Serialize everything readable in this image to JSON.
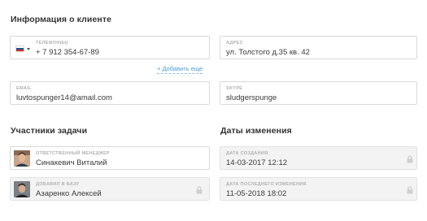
{
  "client_info": {
    "title": "Информация о клиенте",
    "phone": {
      "label": "ТЕЛЕФОН(Ы)",
      "value": "+ 7 912 354-67-89",
      "country_flag": "ru-flag-icon"
    },
    "address": {
      "label": "АДРЕС",
      "value": "ул. Толстого д.35 кв. 42"
    },
    "add_more": "+ Добавить еще",
    "email": {
      "label": "EMAIL",
      "value": "luvtospunger14@amail.com"
    },
    "skype": {
      "label": "SKYPE",
      "value": "sludgerspunge"
    }
  },
  "participants": {
    "title": "Участники задачи",
    "manager": {
      "label": "ОТВЕТСТВЕННЫЙ МЕНЕДЖЕР",
      "value": "Синакевич Виталий"
    },
    "added_by": {
      "label": "ДОБАВИЛ В БАЗУ",
      "value": "Азаренко Алексей"
    }
  },
  "dates": {
    "title": "Даты изменения",
    "created": {
      "label": "ДАТА СОЗДАНИЯ",
      "value": "14-03-2017 12:12"
    },
    "modified": {
      "label": "ДАТА ПОСЛЕДНЕГО ИЗМЕНЕНИЯ",
      "value": "11-05-2018 18:02"
    }
  },
  "colors": {
    "link": "#4a9bd6",
    "border": "#d9d9d9",
    "readonly_bg": "#f3f3f3",
    "label": "#b0b0b0"
  }
}
